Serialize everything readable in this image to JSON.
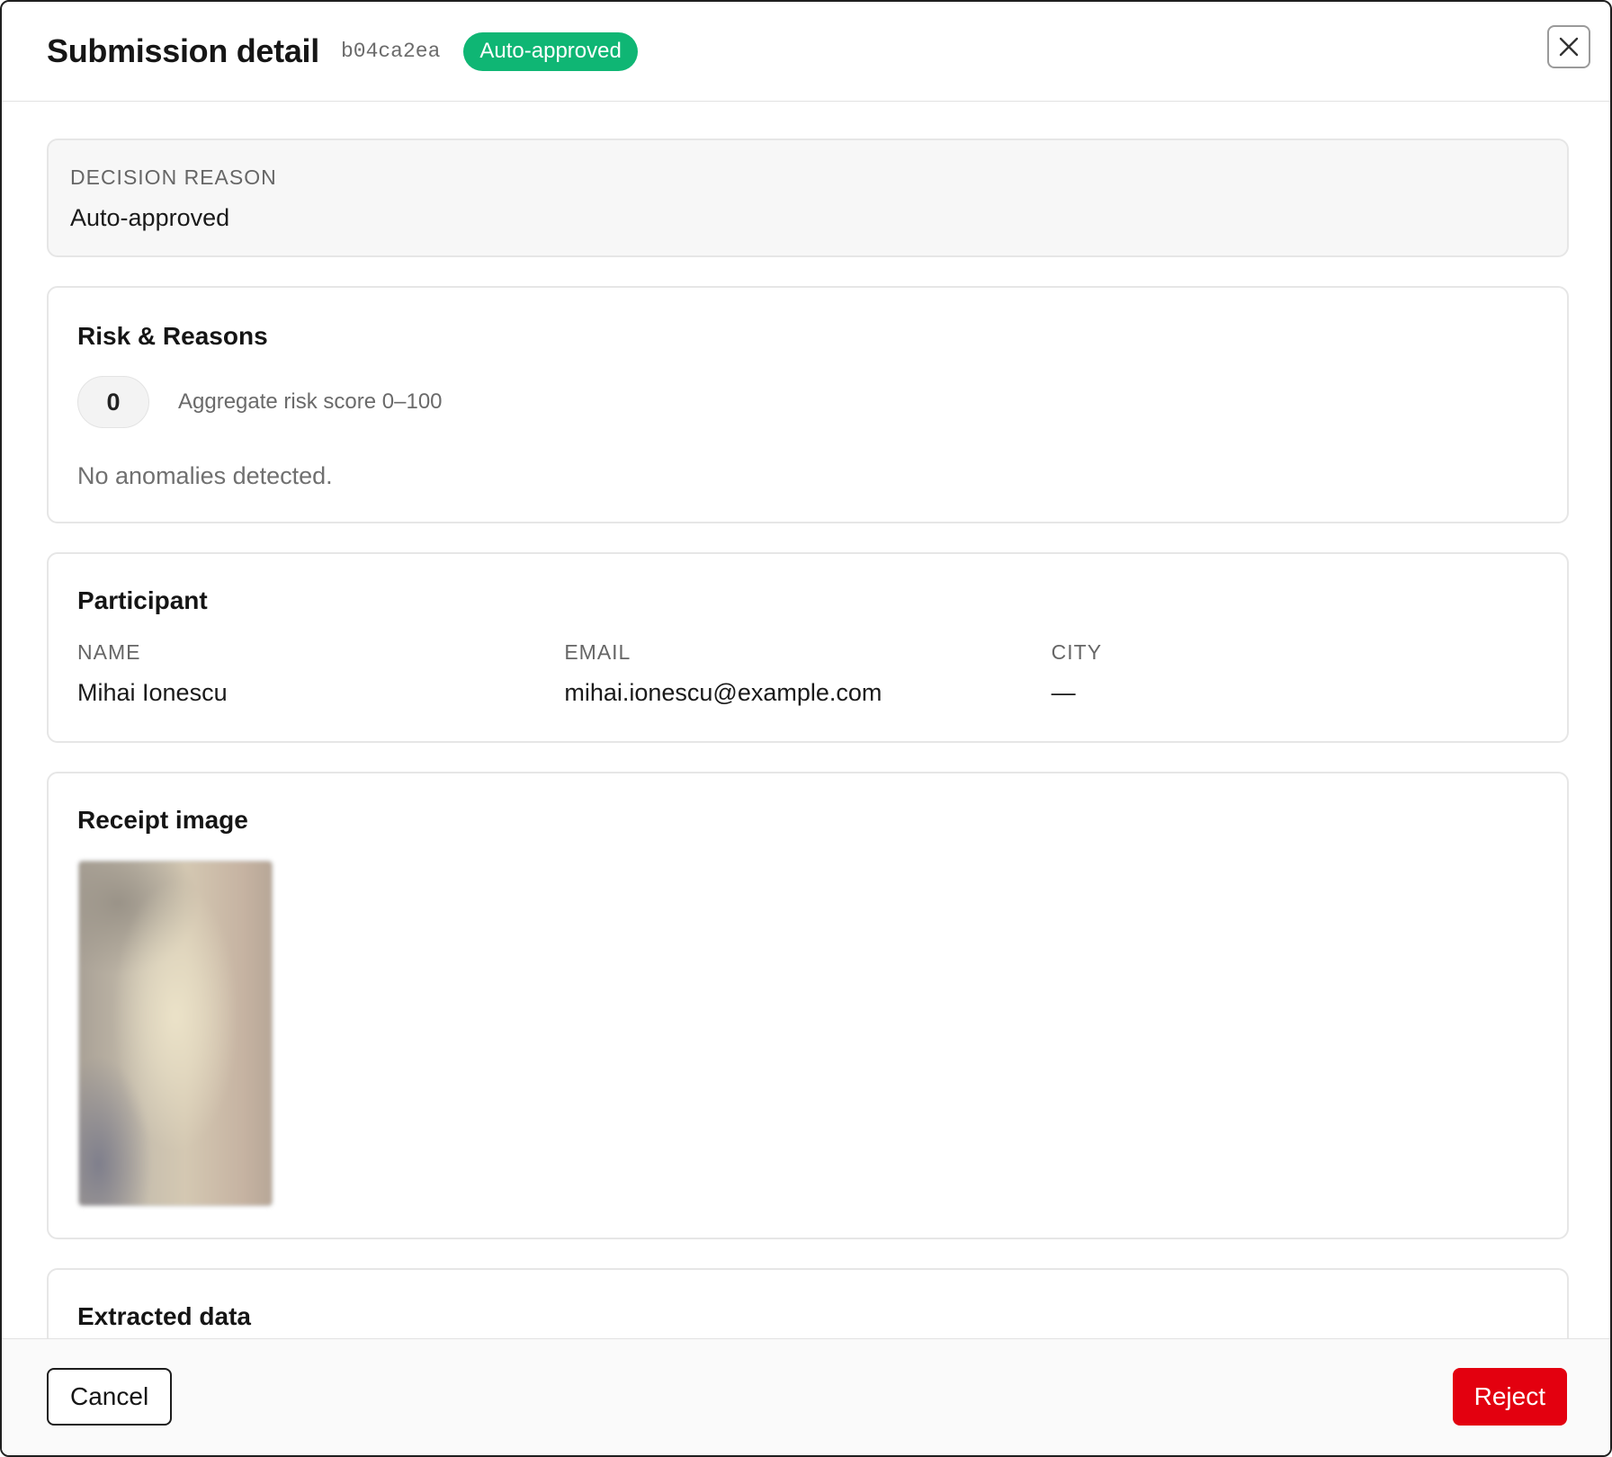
{
  "header": {
    "title": "Submission detail",
    "submission_id": "b04ca2ea",
    "status_badge": "Auto-approved"
  },
  "decision": {
    "label": "DECISION REASON",
    "value": "Auto-approved"
  },
  "risk": {
    "title": "Risk & Reasons",
    "score": "0",
    "score_caption": "Aggregate risk score 0–100",
    "anomalies_text": "No anomalies detected."
  },
  "participant": {
    "title": "Participant",
    "fields": [
      {
        "label": "NAME",
        "value": "Mihai Ionescu"
      },
      {
        "label": "EMAIL",
        "value": "mihai.ionescu@example.com"
      },
      {
        "label": "CITY",
        "value": "—"
      }
    ]
  },
  "receipt": {
    "title": "Receipt image"
  },
  "extracted": {
    "title": "Extracted data"
  },
  "footer": {
    "cancel_label": "Cancel",
    "reject_label": "Reject"
  },
  "colors": {
    "badge_green": "#0fb674",
    "reject_red": "#e3000f"
  },
  "icons": {
    "close": "close-icon"
  }
}
